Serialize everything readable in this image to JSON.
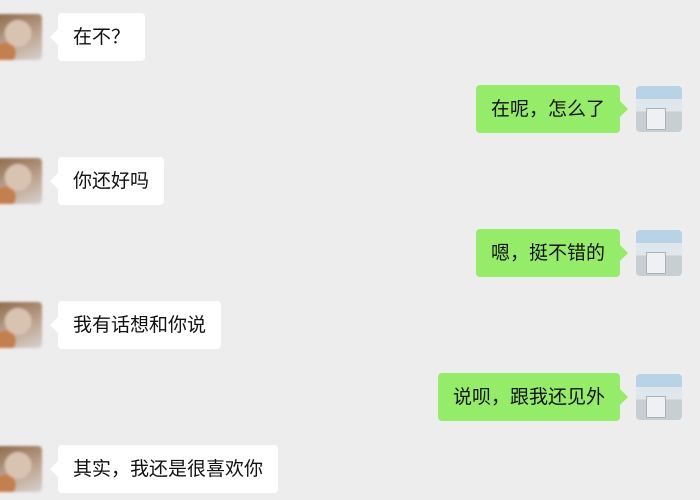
{
  "messages": [
    {
      "side": "incoming",
      "text": "在不？"
    },
    {
      "side": "outgoing",
      "text": "在呢，怎么了"
    },
    {
      "side": "incoming",
      "text": "你还好吗"
    },
    {
      "side": "outgoing",
      "text": "嗯，挺不错的"
    },
    {
      "side": "incoming",
      "text": "我有话想和你说"
    },
    {
      "side": "outgoing",
      "text": "说呗，跟我还见外"
    },
    {
      "side": "incoming",
      "text": "其实，我还是很喜欢你"
    }
  ],
  "colors": {
    "background": "#ededed",
    "incoming_bubble": "#ffffff",
    "outgoing_bubble": "#95ec69",
    "text": "#111111"
  },
  "icons": {
    "incoming_avatar": "blurred-user-avatar-icon",
    "outgoing_avatar": "landscape-avatar-icon"
  }
}
